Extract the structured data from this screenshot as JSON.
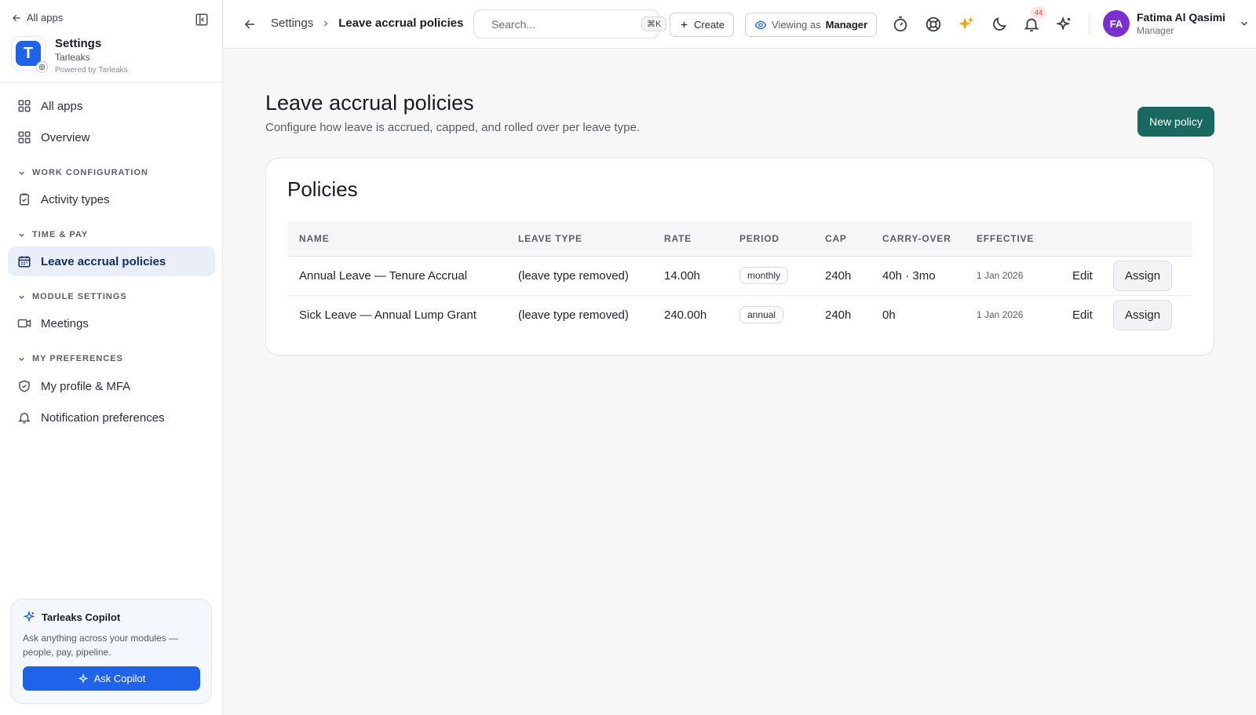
{
  "sidebar": {
    "back_label": "All apps",
    "app": {
      "title": "Settings",
      "org": "Tarleaks",
      "powered": "Powered by Tarleaks",
      "logo_letter": "T"
    },
    "items": [
      {
        "label": "All apps",
        "icon": "grid-icon"
      },
      {
        "label": "Overview",
        "icon": "grid-icon"
      }
    ],
    "sections": [
      {
        "label": "WORK CONFIGURATION",
        "items": [
          {
            "label": "Activity types",
            "icon": "clipboard-icon"
          }
        ]
      },
      {
        "label": "TIME & PAY",
        "items": [
          {
            "label": "Leave accrual policies",
            "icon": "calendar-icon",
            "active": true
          }
        ]
      },
      {
        "label": "MODULE SETTINGS",
        "items": [
          {
            "label": "Meetings",
            "icon": "video-icon"
          }
        ]
      },
      {
        "label": "MY PREFERENCES",
        "items": [
          {
            "label": "My profile & MFA",
            "icon": "shield-icon"
          },
          {
            "label": "Notification preferences",
            "icon": "bell-icon"
          }
        ]
      }
    ],
    "copilot": {
      "title": "Tarleaks Copilot",
      "description": "Ask anything across your modules — people, pay, pipeline.",
      "button": "Ask Copilot"
    }
  },
  "topbar": {
    "breadcrumb": {
      "parent": "Settings",
      "current": "Leave accrual policies"
    },
    "search": {
      "placeholder": "Search...",
      "shortcut": "⌘K"
    },
    "create_label": "Create",
    "viewing_as": {
      "prefix": "Viewing as",
      "role": "Manager"
    },
    "notifications_count": "44",
    "user": {
      "initials": "FA",
      "name": "Fatima Al Qasimi",
      "role": "Manager"
    }
  },
  "main": {
    "title": "Leave accrual policies",
    "description": "Configure how leave is accrued, capped, and rolled over per leave type.",
    "new_policy_label": "New policy",
    "card_title": "Policies",
    "columns": [
      "NAME",
      "LEAVE TYPE",
      "RATE",
      "PERIOD",
      "CAP",
      "CARRY-OVER",
      "EFFECTIVE"
    ],
    "rows": [
      {
        "name": "Annual Leave — Tenure Accrual",
        "leave_type": "(leave type removed)",
        "rate": "14.00h",
        "period": "monthly",
        "cap": "240h",
        "carry_over": "40h · 3mo",
        "effective": "1 Jan 2026",
        "edit": "Edit",
        "assign": "Assign"
      },
      {
        "name": "Sick Leave — Annual Lump Grant",
        "leave_type": "(leave type removed)",
        "rate": "240.00h",
        "period": "annual",
        "cap": "240h",
        "carry_over": "0h",
        "effective": "1 Jan 2026",
        "edit": "Edit",
        "assign": "Assign"
      }
    ]
  },
  "colors": {
    "accent": "#186a60",
    "copilot_blue": "#1e63e9",
    "avatar": "#7b2fd0",
    "sparkle": "#f0a21a"
  }
}
